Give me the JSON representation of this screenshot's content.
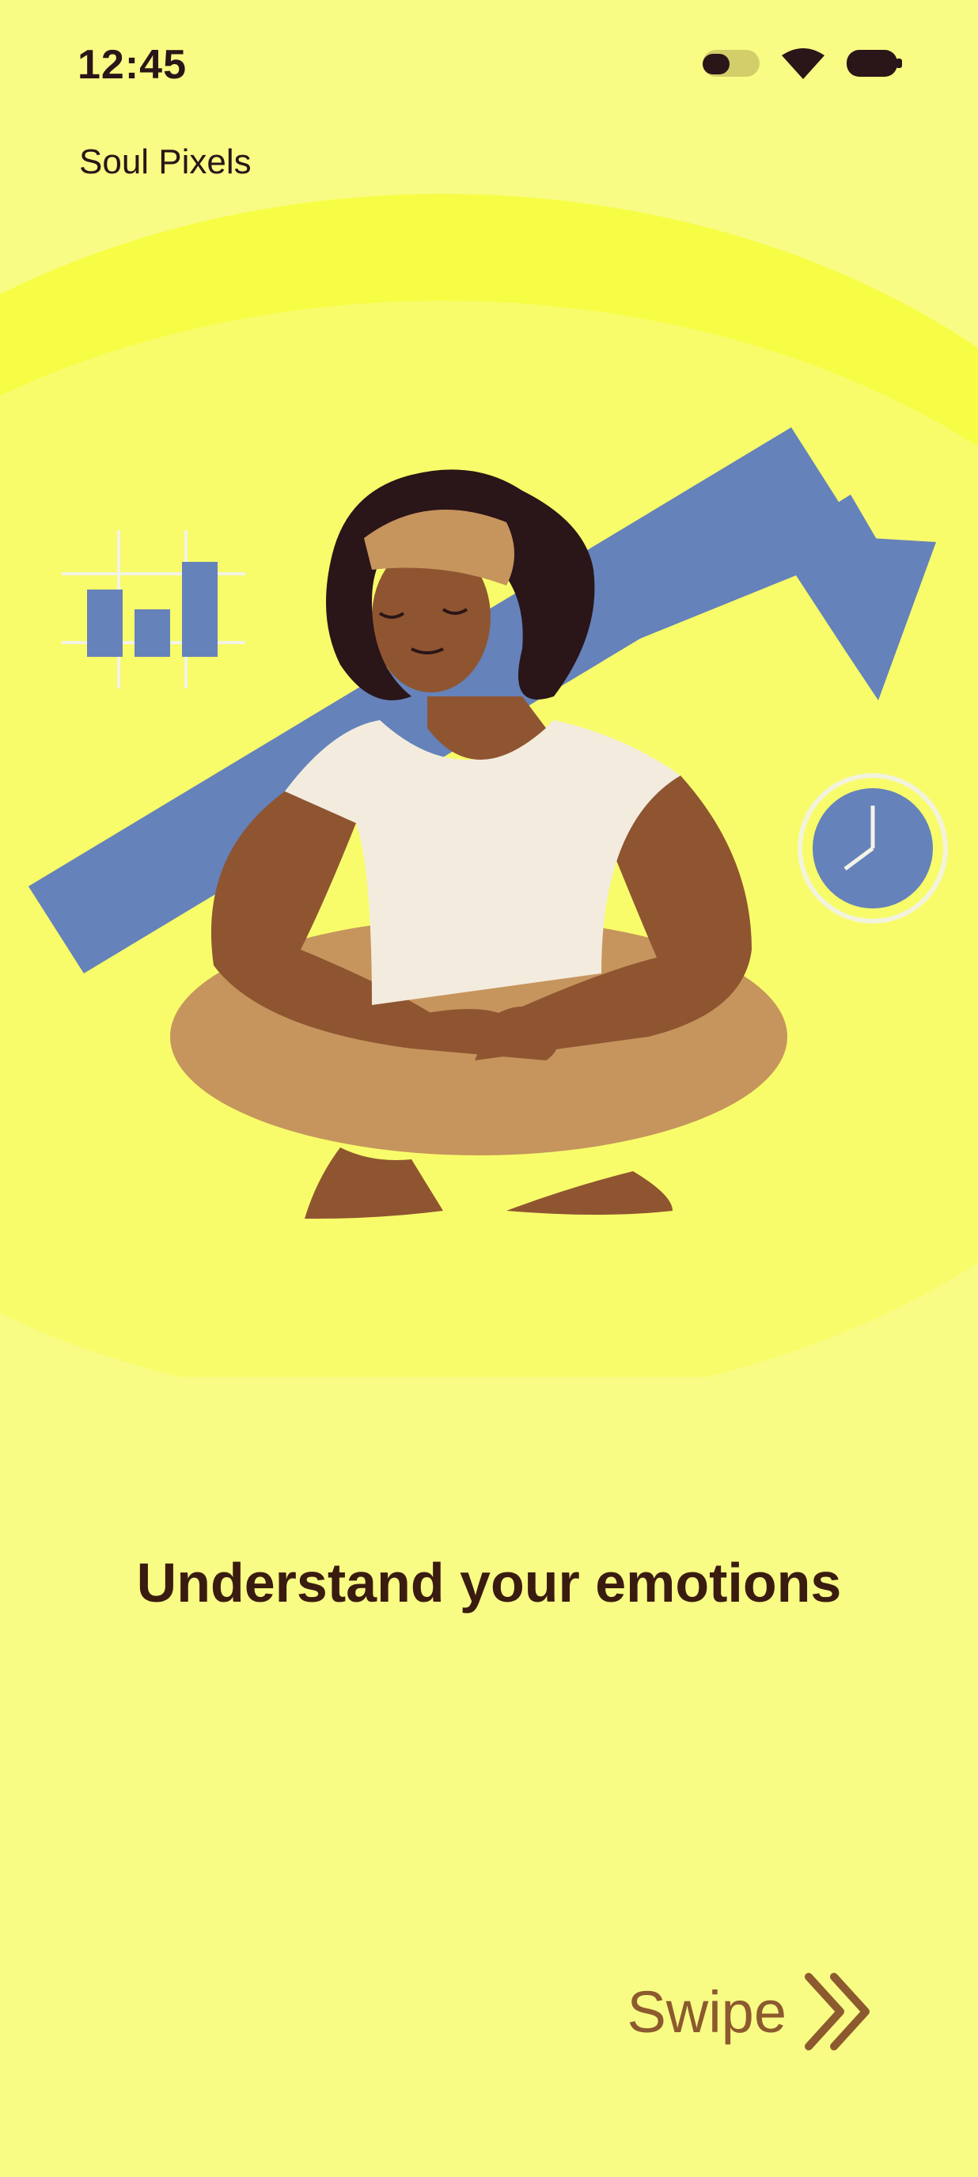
{
  "status_bar": {
    "time": "12:45",
    "icons": [
      "toggle-icon",
      "wifi-icon",
      "battery-icon"
    ]
  },
  "app": {
    "title": "Soul Pixels"
  },
  "onboarding": {
    "headline": "Understand your emotions",
    "swipe_label": "Swipe"
  },
  "colors": {
    "background": "#F8FC84",
    "ring": "#F7FD45",
    "accent_blue": "#6582BA",
    "text_dark": "#2A1518",
    "swipe_brown": "#8C5A2E"
  }
}
